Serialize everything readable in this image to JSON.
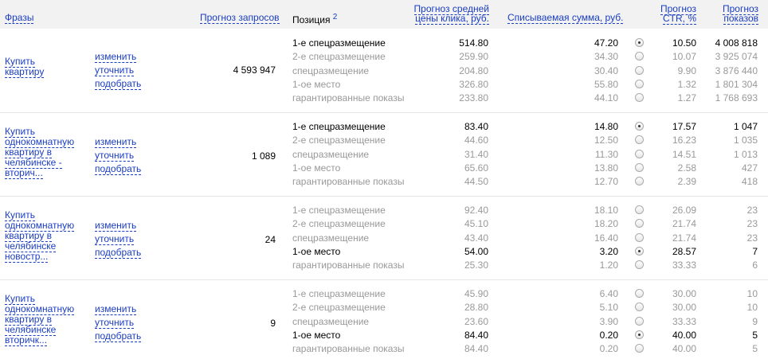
{
  "header": {
    "phrases": "Фразы",
    "forecast_requests": "Прогноз запросов",
    "position": "Позиция",
    "position_note": "2",
    "avg_click_price_l1": "Прогноз средней",
    "avg_click_price_l2": "цены клика, руб.",
    "charged_sum": "Списываемая сумма, руб.",
    "ctr_l1": "Прогноз",
    "ctr_l2": "CTR, %",
    "shows_l1": "Прогноз",
    "shows_l2": "показов"
  },
  "actions": {
    "change": "изменить",
    "refine": "уточнить",
    "pick": "подобрать"
  },
  "blocks": [
    {
      "phrase_lines": [
        "Купить",
        "квартиру"
      ],
      "forecast": "4 593 947",
      "rows": [
        {
          "position": "1-е спецразмещение",
          "price": "514.80",
          "amount": "47.20",
          "selected": true,
          "ctr": "10.50",
          "shows": "4 008 818"
        },
        {
          "position": "2-е спецразмещение",
          "price": "259.90",
          "amount": "34.30",
          "selected": false,
          "ctr": "10.07",
          "shows": "3 925 074"
        },
        {
          "position": "спецразмещение",
          "price": "204.80",
          "amount": "30.40",
          "selected": false,
          "ctr": "9.90",
          "shows": "3 876 440"
        },
        {
          "position": "1-ое место",
          "price": "326.80",
          "amount": "55.80",
          "selected": false,
          "ctr": "1.32",
          "shows": "1 801 304"
        },
        {
          "position": "гарантированные показы",
          "price": "233.80",
          "amount": "44.10",
          "selected": false,
          "ctr": "1.27",
          "shows": "1 768 693"
        }
      ]
    },
    {
      "phrase_lines": [
        "Купить",
        "однокомнатную",
        "квартиру в",
        "челябинске -",
        "вторич..."
      ],
      "forecast": "1 089",
      "rows": [
        {
          "position": "1-е спецразмещение",
          "price": "83.40",
          "amount": "14.80",
          "selected": true,
          "ctr": "17.57",
          "shows": "1 047"
        },
        {
          "position": "2-е спецразмещение",
          "price": "44.60",
          "amount": "12.50",
          "selected": false,
          "ctr": "16.23",
          "shows": "1 035"
        },
        {
          "position": "спецразмещение",
          "price": "31.40",
          "amount": "11.30",
          "selected": false,
          "ctr": "14.51",
          "shows": "1 013"
        },
        {
          "position": "1-ое место",
          "price": "65.60",
          "amount": "13.80",
          "selected": false,
          "ctr": "2.58",
          "shows": "427"
        },
        {
          "position": "гарантированные показы",
          "price": "44.50",
          "amount": "12.70",
          "selected": false,
          "ctr": "2.39",
          "shows": "418"
        }
      ]
    },
    {
      "phrase_lines": [
        "Купить",
        "однокомнатную",
        "квартиру в",
        "челябинске",
        "новостр..."
      ],
      "forecast": "24",
      "rows": [
        {
          "position": "1-е спецразмещение",
          "price": "92.40",
          "amount": "18.10",
          "selected": false,
          "ctr": "26.09",
          "shows": "23"
        },
        {
          "position": "2-е спецразмещение",
          "price": "45.10",
          "amount": "18.20",
          "selected": false,
          "ctr": "21.74",
          "shows": "23"
        },
        {
          "position": "спецразмещение",
          "price": "43.40",
          "amount": "16.40",
          "selected": false,
          "ctr": "21.74",
          "shows": "23"
        },
        {
          "position": "1-ое место",
          "price": "54.00",
          "amount": "3.20",
          "selected": true,
          "ctr": "28.57",
          "shows": "7"
        },
        {
          "position": "гарантированные показы",
          "price": "25.30",
          "amount": "1.20",
          "selected": false,
          "ctr": "33.33",
          "shows": "6"
        }
      ]
    },
    {
      "phrase_lines": [
        "Купить",
        "однокомнатную",
        "квартиру в",
        "челябинске",
        "вторичк..."
      ],
      "forecast": "9",
      "rows": [
        {
          "position": "1-е спецразмещение",
          "price": "45.90",
          "amount": "6.40",
          "selected": false,
          "ctr": "30.00",
          "shows": "10"
        },
        {
          "position": "2-е спецразмещение",
          "price": "28.80",
          "amount": "5.10",
          "selected": false,
          "ctr": "30.00",
          "shows": "10"
        },
        {
          "position": "спецразмещение",
          "price": "23.60",
          "amount": "3.90",
          "selected": false,
          "ctr": "33.33",
          "shows": "9"
        },
        {
          "position": "1-ое место",
          "price": "84.40",
          "amount": "0.20",
          "selected": true,
          "ctr": "40.00",
          "shows": "5"
        },
        {
          "position": "гарантированные показы",
          "price": "84.40",
          "amount": "0.20",
          "selected": false,
          "ctr": "40.00",
          "shows": "5"
        }
      ]
    }
  ]
}
